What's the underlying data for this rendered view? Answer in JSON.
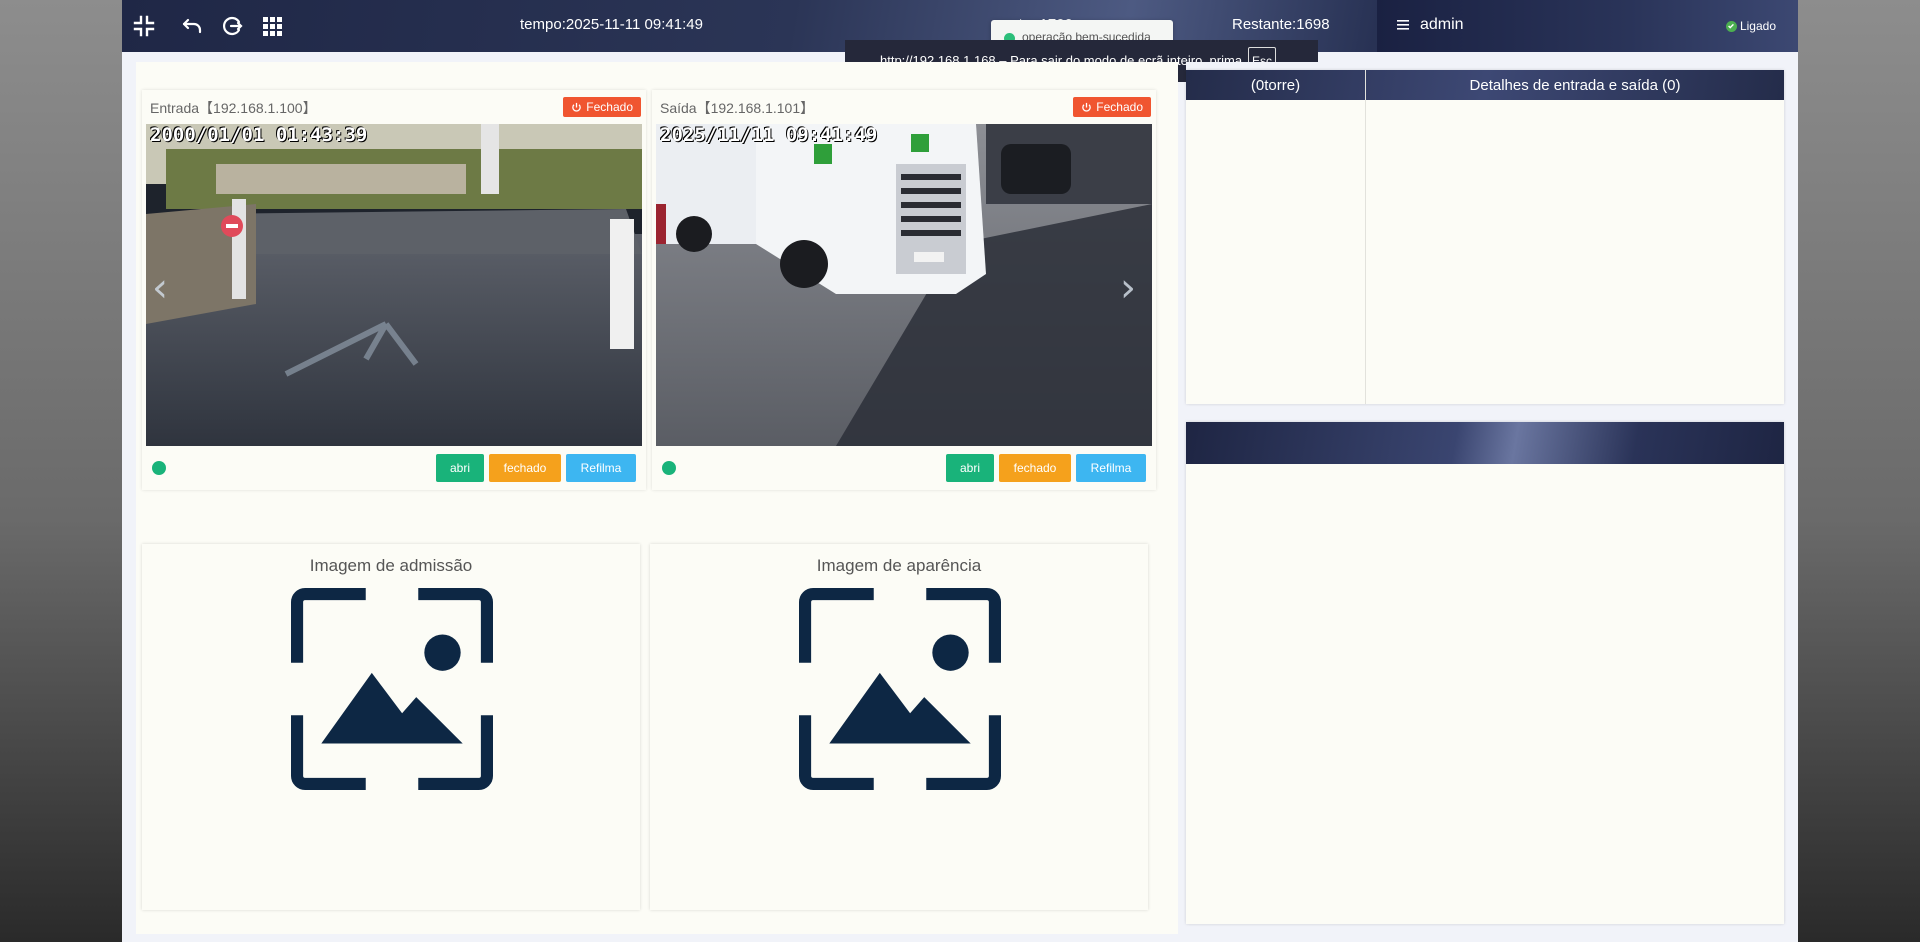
{
  "topbar": {
    "time": "tempo:2025-11-11 09:41:49",
    "total": "ento:  1700",
    "remaining": "Restante:1698",
    "username": "admin",
    "status": "Ligado"
  },
  "toast": {
    "message": "operação bem-sucedida"
  },
  "fullscreen_notice": {
    "text": "http://192.168.1.168 – Para sair do modo de ecrã inteiro, prima",
    "key": "Esc"
  },
  "cameras": [
    {
      "title": "Entrada【192.168.1.100】",
      "badge": "Fechado",
      "timestamp": "2000/01/01 01:43:39",
      "buttons": {
        "open": "abri",
        "close": "fechado",
        "refilm": "Refilma"
      }
    },
    {
      "title": "Saída【192.168.1.101】",
      "badge": "Fechado",
      "timestamp": "2025/11/11 09:41:49",
      "buttons": {
        "open": "abri",
        "close": "fechado",
        "refilm": "Refilma"
      }
    }
  ],
  "images": {
    "admission": "Imagem de admissão",
    "appearance": "Imagem de aparência"
  },
  "table": {
    "col1": "(0torre)",
    "col2": "Detalhes de entrada e saída  (0)"
  },
  "colors": {
    "accent_green": "#19b37a",
    "accent_orange": "#f5a11c",
    "accent_blue": "#3db6f1",
    "badge_red": "#f05530",
    "header_navy": "#242c4a",
    "placeholder_navy": "#0d2744"
  }
}
